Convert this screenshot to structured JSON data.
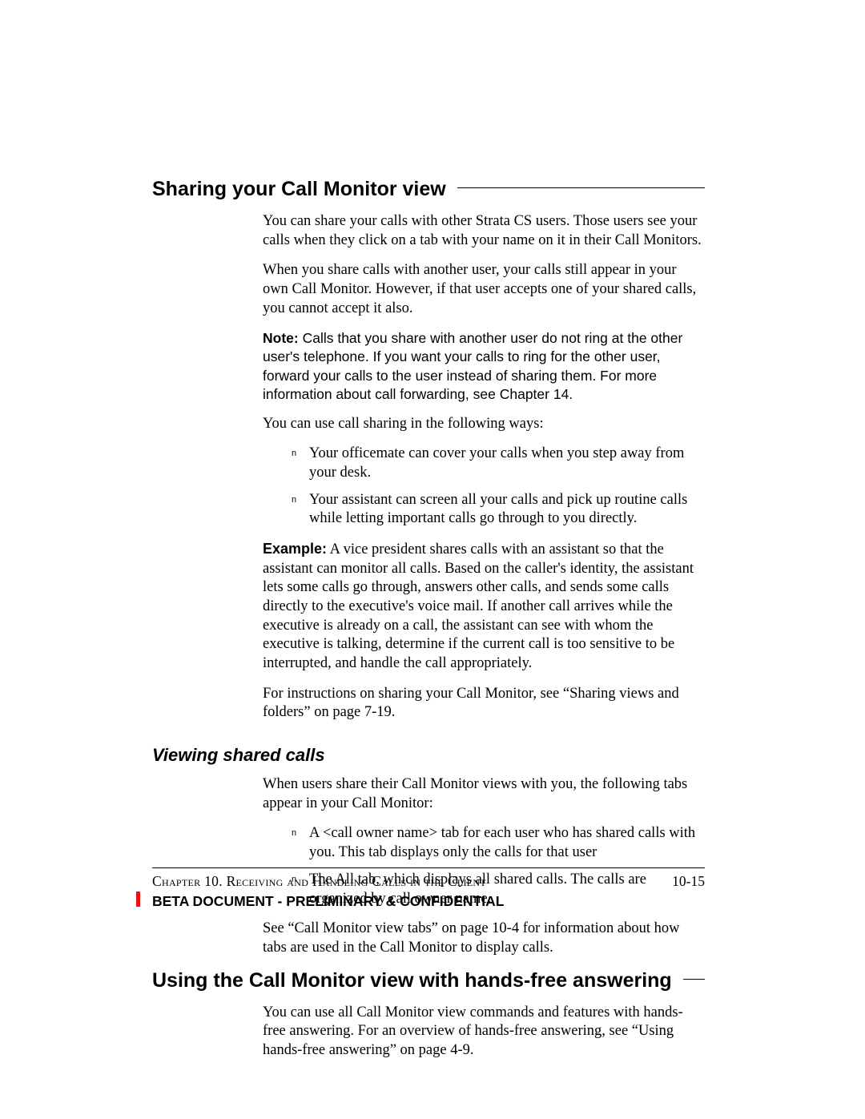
{
  "section1": {
    "heading": "Sharing your Call Monitor view",
    "p1": "You can share your calls with other Strata CS users. Those users see your calls when they click on a tab with your name on it in their Call Monitors.",
    "p2": "When you share calls with another user, your calls still appear in your own Call Monitor. However, if that user accepts one of your shared calls, you cannot accept it also.",
    "note_label": "Note:",
    "note": "  Calls that you share with another user do not ring at the other user's telephone. If you want your calls to ring for the other user, forward your calls to the user instead of sharing them. For more information about call forwarding, see Chapter 14.",
    "p3": "You can use call sharing in the following ways:",
    "bullets": [
      "Your officemate can cover your calls when you step away from your desk.",
      "Your assistant can screen all your calls and pick up routine calls while letting important calls go through to you directly."
    ],
    "example_label": "Example:",
    "example": " A vice president shares calls with an assistant so that the assistant can monitor all calls. Based on the caller's identity, the assistant lets some calls go through, answers other calls, and sends some calls directly to the executive's voice mail. If another call arrives while the executive is already on a call, the assistant can see with whom the executive is talking, determine if the current call is too sensitive to be interrupted, and handle the call appropriately.",
    "p4": "For instructions on sharing your Call Monitor, see “Sharing views and folders” on page 7-19."
  },
  "subsection": {
    "heading": "Viewing shared calls",
    "p1": "When users share their Call Monitor views with you, the following tabs appear in your Call Monitor:",
    "bullets": [
      "A <call owner name> tab for each user who has shared calls with you. This tab displays only the calls for that user",
      "The All tab, which displays all shared calls. The calls are organized by call owner name."
    ],
    "p2": "See “Call Monitor view tabs” on page 10-4 for information about how tabs are used in the Call Monitor to display calls."
  },
  "section2": {
    "heading": "Using the Call Monitor view with hands-free answering",
    "p1": "You can use all Call Monitor view commands and features with hands-free answering. For an overview of hands-free answering, see “Using hands-free answering” on page 4-9."
  },
  "footer": {
    "chapter": "Chapter 10. Receiving and Handling Calls in the Client",
    "page": "10-15",
    "beta": "BETA DOCUMENT - PRELIMINARY & CONFIDENTIAL"
  }
}
